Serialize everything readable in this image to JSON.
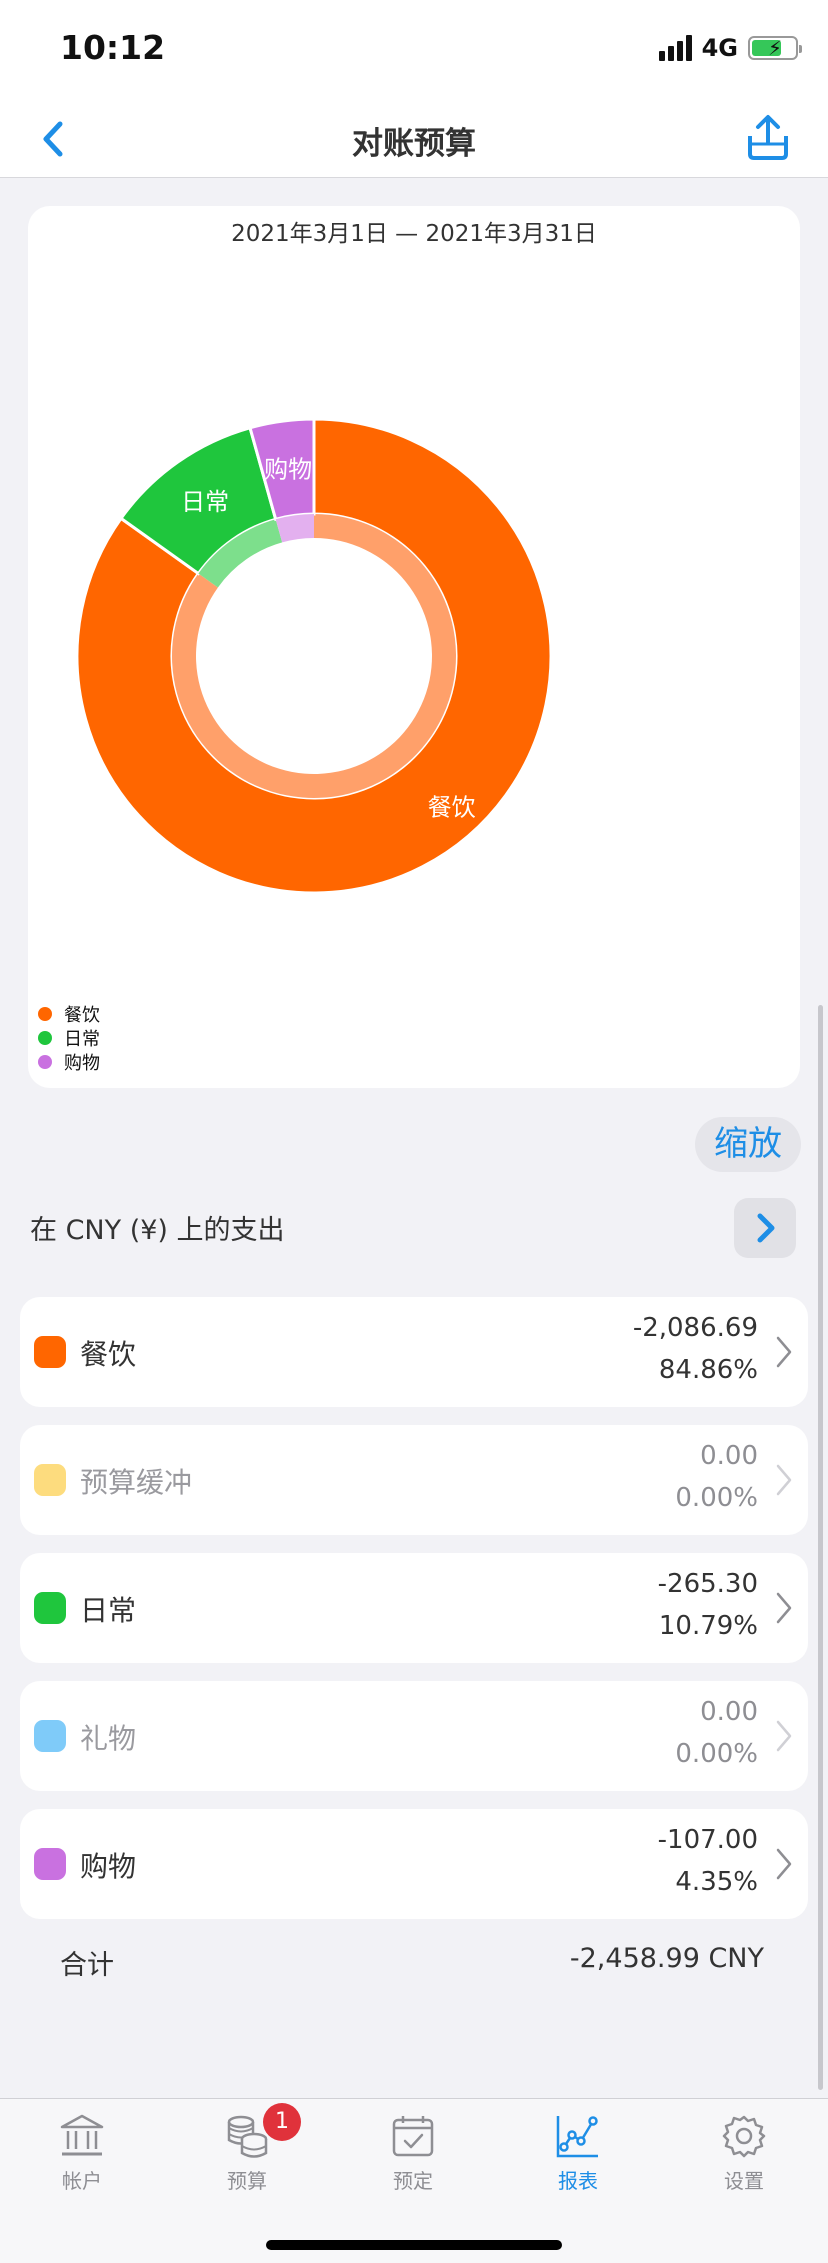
{
  "status_bar": {
    "time": "10:12",
    "network": "4G"
  },
  "nav": {
    "title": "对账预算",
    "back_icon": "chevron-left-icon",
    "share_icon": "share-icon"
  },
  "chart_card": {
    "date_range": "2021年3月1日 — 2021年3月31日",
    "slice_labels": [
      "餐饮",
      "日常",
      "购物"
    ]
  },
  "chart_data": {
    "type": "pie",
    "categories": [
      "餐饮",
      "日常",
      "购物"
    ],
    "values": [
      84.86,
      10.79,
      4.35
    ],
    "colors": [
      "#ff6600",
      "#1fc63d",
      "#c971e0"
    ],
    "inner_colors": [
      "#ffa06a",
      "#7ddf8c",
      "#e3b0ef"
    ],
    "legend": [
      "餐饮",
      "日常",
      "购物"
    ],
    "legend_placement": "bottom-left",
    "donut": true
  },
  "zoom_label": "缩放",
  "section": {
    "title": "在 CNY (¥) 上的支出"
  },
  "categories": [
    {
      "name": "餐饮",
      "amount": "-2,086.69",
      "percent": "84.86%",
      "color": "#ff6600",
      "muted": false
    },
    {
      "name": "预算缓冲",
      "amount": "0.00",
      "percent": "0.00%",
      "color": "#fddc7e",
      "muted": true
    },
    {
      "name": "日常",
      "amount": "-265.30",
      "percent": "10.79%",
      "color": "#1fc63d",
      "muted": false
    },
    {
      "name": "礼物",
      "amount": "0.00",
      "percent": "0.00%",
      "color": "#7fcbf9",
      "muted": true
    },
    {
      "name": "购物",
      "amount": "-107.00",
      "percent": "4.35%",
      "color": "#c971e0",
      "muted": false
    }
  ],
  "total": {
    "label": "合计",
    "value": "-2,458.99 CNY"
  },
  "tabs": [
    {
      "label": "帐户",
      "icon": "bank-icon",
      "active": false
    },
    {
      "label": "预算",
      "icon": "coins-icon",
      "active": false,
      "badge": "1"
    },
    {
      "label": "预定",
      "icon": "calendar-check-icon",
      "active": false
    },
    {
      "label": "报表",
      "icon": "chart-line-icon",
      "active": true
    },
    {
      "label": "设置",
      "icon": "gear-icon",
      "active": false
    }
  ]
}
